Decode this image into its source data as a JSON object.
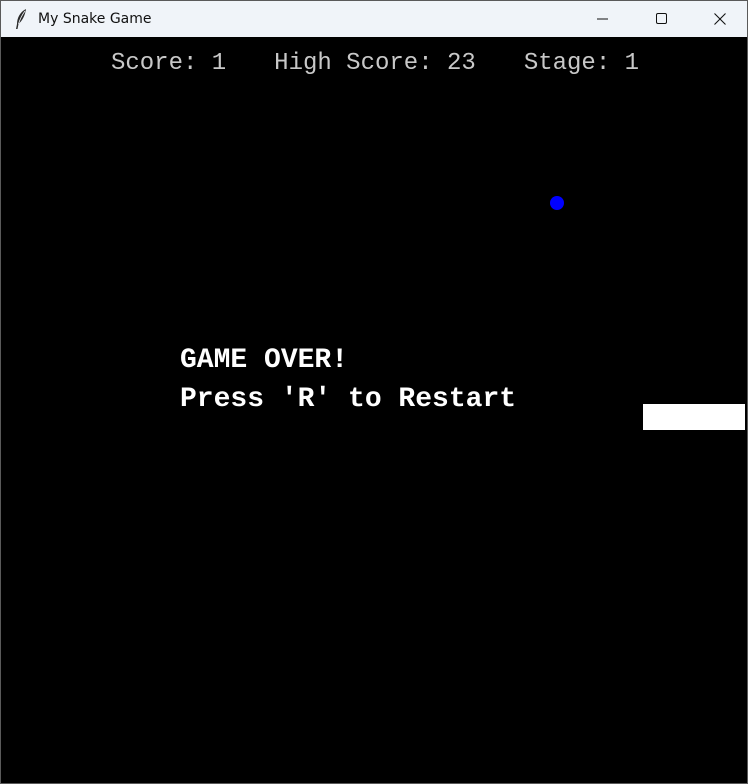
{
  "window": {
    "title": "My Snake Game",
    "icon": "feather-icon",
    "controls": [
      "minimize-icon",
      "maximize-icon",
      "close-icon"
    ]
  },
  "hud": {
    "score_label": "Score: 1",
    "high_score_label": "High Score: 23",
    "stage_label": "Stage: 1"
  },
  "game_over": {
    "line1": "GAME OVER!",
    "line2": "Press 'R' to Restart"
  },
  "colors": {
    "background": "#000000",
    "food": "#0000ff",
    "snake": "#ffffff",
    "hud_text": "#c8c8c8",
    "message_text": "#ffffff"
  }
}
